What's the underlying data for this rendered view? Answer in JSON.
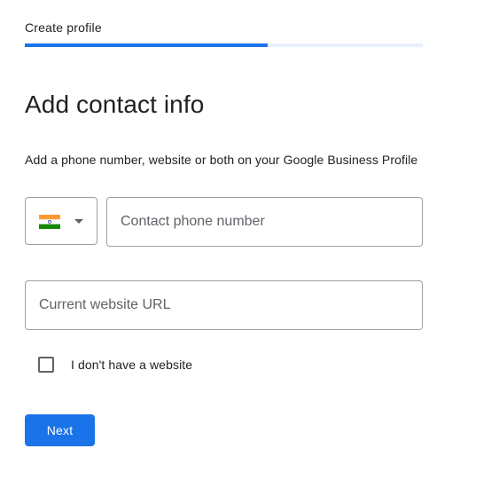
{
  "header": {
    "label": "Create profile",
    "progress_fraction": 0.61
  },
  "main": {
    "title": "Add contact info",
    "subtitle": "Add a phone number, website or both on your Google Business Profile",
    "country_select": {
      "flag_icon": "india-flag-icon",
      "dropdown_icon": "caret-down-icon"
    },
    "phone_field": {
      "placeholder": "Contact phone number",
      "value": ""
    },
    "website_field": {
      "placeholder": "Current website URL",
      "value": ""
    },
    "no_website_checkbox": {
      "label": "I don't have a website",
      "checked": false
    },
    "next_button": {
      "label": "Next"
    }
  },
  "colors": {
    "accent": "#1a73e8",
    "track": "#e8f0fe",
    "border": "#9aa0a6",
    "text": "#202124",
    "placeholder": "#5f6368"
  }
}
